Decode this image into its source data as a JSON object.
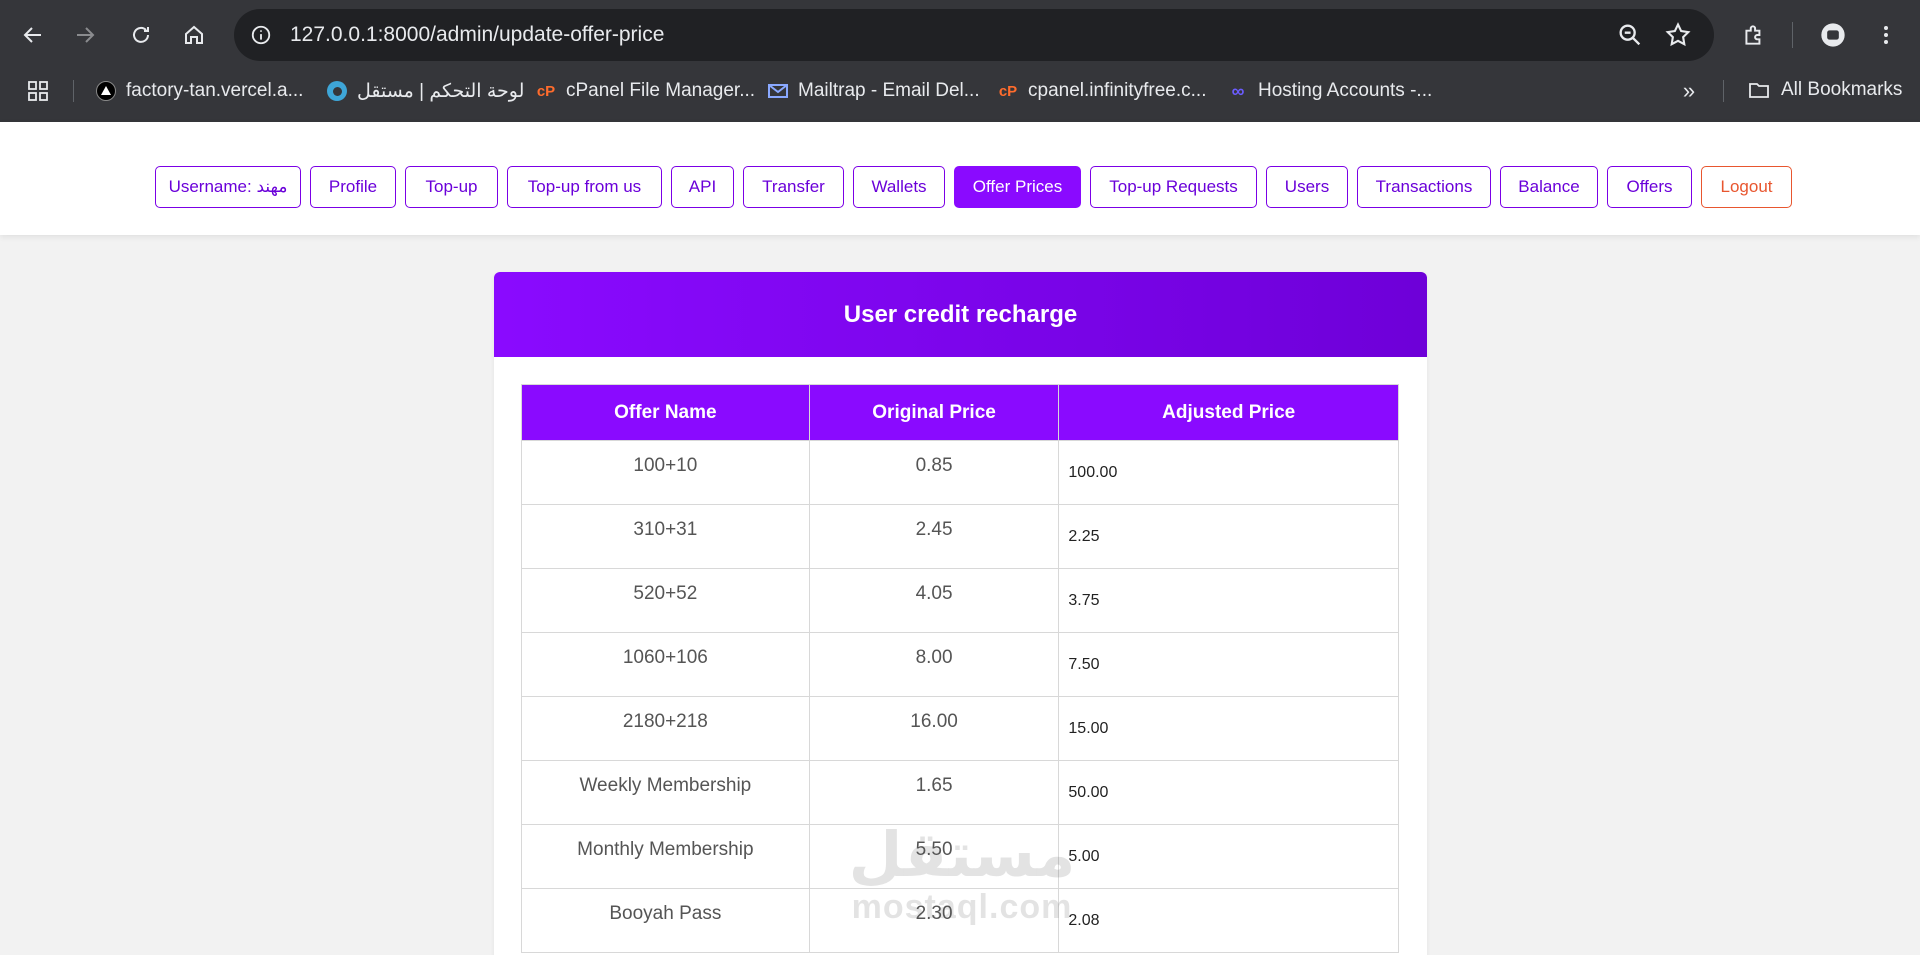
{
  "browser": {
    "url": "127.0.0.1:8000/admin/update-offer-price",
    "bookmarks": [
      {
        "label": "factory-tan.vercel.a...",
        "icon": "vercel-icon"
      },
      {
        "label": "لوحة التحكم | مستقل",
        "icon": "mostaql-icon"
      },
      {
        "label": "cPanel File Manager...",
        "icon": "cpanel-icon"
      },
      {
        "label": "Mailtrap - Email Del...",
        "icon": "mailtrap-icon"
      },
      {
        "label": "cpanel.infinityfree.c...",
        "icon": "cpanel-icon"
      },
      {
        "label": "Hosting Accounts -...",
        "icon": "infinity-icon"
      }
    ],
    "all_bookmarks": "All Bookmarks"
  },
  "nav": {
    "items": [
      {
        "label": "Username: مهند"
      },
      {
        "label": "Profile"
      },
      {
        "label": "Top-up"
      },
      {
        "label": "Top-up from us"
      },
      {
        "label": "API"
      },
      {
        "label": "Transfer"
      },
      {
        "label": "Wallets"
      },
      {
        "label": "Offer Prices",
        "active": true
      },
      {
        "label": "Top-up Requests"
      },
      {
        "label": "Users"
      },
      {
        "label": "Transactions"
      },
      {
        "label": "Balance"
      },
      {
        "label": "Offers"
      },
      {
        "label": "Logout"
      }
    ]
  },
  "card": {
    "title": "User credit recharge",
    "columns": [
      "Offer Name",
      "Original Price",
      "Adjusted Price"
    ],
    "rows": [
      {
        "name": "100+10",
        "original": "0.85",
        "adjusted": "100.00"
      },
      {
        "name": "310+31",
        "original": "2.45",
        "adjusted": "2.25"
      },
      {
        "name": "520+52",
        "original": "4.05",
        "adjusted": "3.75"
      },
      {
        "name": "1060+106",
        "original": "8.00",
        "adjusted": "7.50"
      },
      {
        "name": "2180+218",
        "original": "16.00",
        "adjusted": "15.00"
      },
      {
        "name": "Weekly Membership",
        "original": "1.65",
        "adjusted": "50.00"
      },
      {
        "name": "Monthly Membership",
        "original": "5.50",
        "adjusted": "5.00"
      },
      {
        "name": "Booyah Pass",
        "original": "2.30",
        "adjusted": "2.08"
      }
    ]
  },
  "watermark": {
    "arabic": "مستقل",
    "latin": "mostaql.com"
  },
  "colors": {
    "accent": "#8a0aff",
    "logout": "#e8562f",
    "chrome": "#35363a"
  }
}
